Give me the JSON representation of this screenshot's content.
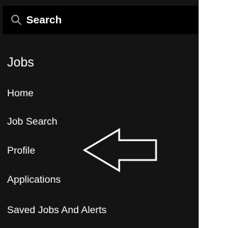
{
  "search": {
    "placeholder": "Search",
    "icon": "search-icon"
  },
  "menu": {
    "section_title": "Jobs",
    "items": [
      {
        "label": "Home"
      },
      {
        "label": "Job Search"
      },
      {
        "label": "Profile"
      },
      {
        "label": "Applications"
      },
      {
        "label": "Saved Jobs And Alerts"
      }
    ]
  },
  "annotation": {
    "icon": "left-arrow-icon",
    "color": "#ffffff"
  },
  "colors": {
    "panel_background": "#141414",
    "search_background": "#000000",
    "text": "#ffffff"
  }
}
